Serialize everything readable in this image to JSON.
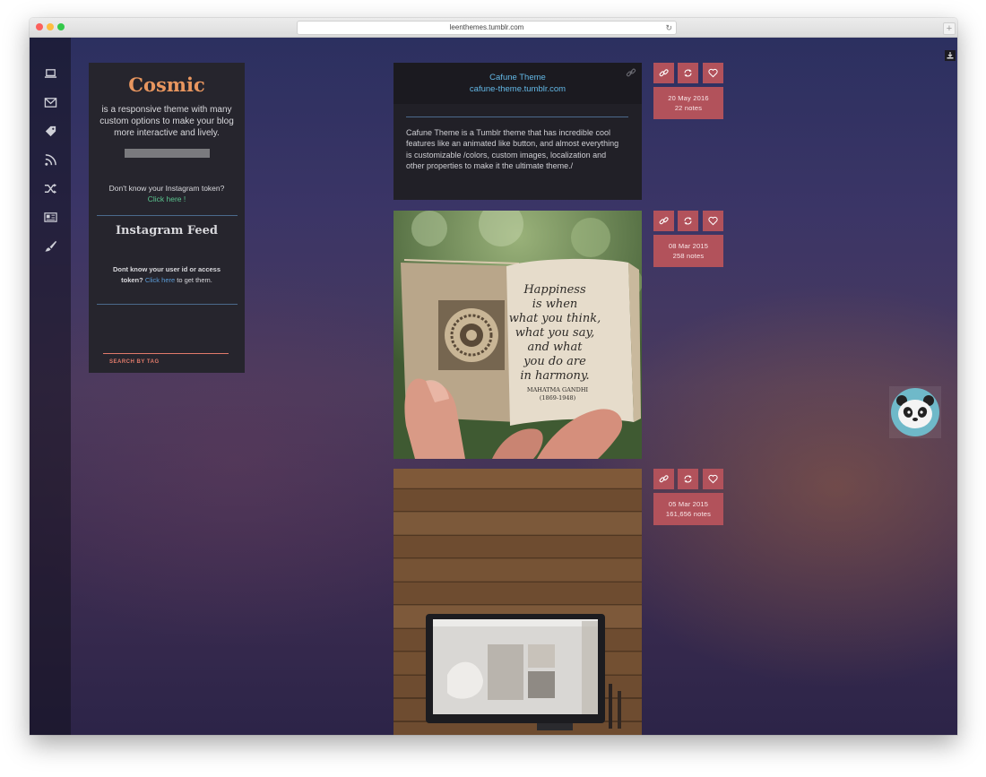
{
  "browser": {
    "url": "leenthemes.tumblr.com"
  },
  "sidebar_nav": {
    "icons": [
      "laptop-icon",
      "mail-icon",
      "tag-icon",
      "rss-icon",
      "shuffle-icon",
      "newspaper-icon",
      "brush-icon"
    ]
  },
  "side_card": {
    "brand": "Cosmic",
    "description": "is a responsive theme with many custom options to make your blog more interactive and lively.",
    "instagram_question": "Don't know your Instagram token?",
    "instagram_link": "Click here !",
    "feed_title": "Instagram Feed",
    "userid_question": "Dont know your user id or access token?",
    "userid_link": "Click here",
    "userid_tail": " to get them.",
    "search_label": "SEARCH BY TAG"
  },
  "posts": [
    {
      "title": "Cafune Theme",
      "subtitle": "cafune-theme.tumblr.com",
      "body": "Cafune Theme is a Tumblr theme that has incredible cool features like an animated like button, and almost everything is customizable /colors, custom images, localization and other properties to make it the ultimate theme./",
      "date": "20 May 2016",
      "notes": "22 notes"
    },
    {
      "image": "book-photo",
      "quote_lines": [
        "Happiness",
        "is when",
        "what you think,",
        "what you say,",
        "and what",
        "you do are",
        "in harmony."
      ],
      "author": "MAHATMA GANDHI",
      "years": "(1869-1948)",
      "date": "08 Mar 2015",
      "notes": "258 notes"
    },
    {
      "image": "desk-laptop-photo",
      "date": "05 Mar 2015",
      "notes": "161,656 notes"
    }
  ],
  "colors": {
    "accent": "#b2525b",
    "brand": "#e8965f",
    "link": "#63b8e6",
    "green_link": "#5bc48f"
  }
}
